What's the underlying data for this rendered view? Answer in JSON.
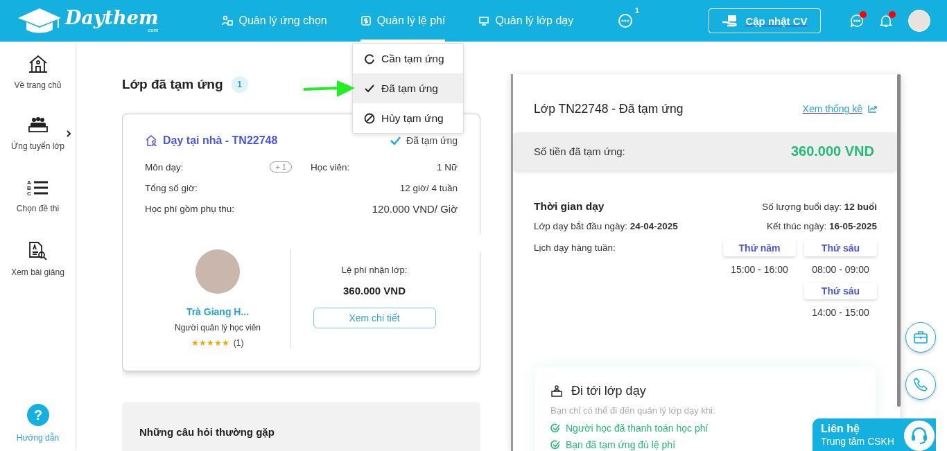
{
  "header": {
    "logo": {
      "name": "Daythem",
      "suffix": "com"
    },
    "nav": [
      {
        "label": "Quản lý ứng chọn",
        "selected": false
      },
      {
        "label": "Quản lý lệ phí",
        "selected": true
      },
      {
        "label": "Quản lý lớp dạy",
        "selected": false
      }
    ],
    "more_badge": "1",
    "cv_button": "Cập nhật CV",
    "chat_unread": true,
    "bell_unread": true
  },
  "fee_menu": {
    "items": [
      {
        "label": "Cần tạm ứng",
        "selected": false
      },
      {
        "label": "Đã tạm ứng",
        "selected": true
      },
      {
        "label": "Hủy tạm ứng",
        "selected": false
      }
    ]
  },
  "sidebar": {
    "items": [
      {
        "label": "Về trang chủ",
        "has_submenu": false
      },
      {
        "label": "Ứng tuyển lớp",
        "has_submenu": true
      },
      {
        "label": "Chọn đề thi",
        "has_submenu": false,
        "icon_letters": [
          "A",
          "B",
          "C"
        ]
      },
      {
        "label": "Xem bài giảng",
        "has_submenu": false
      }
    ],
    "help_icon": "?",
    "help": "Hướng dẫn"
  },
  "section": {
    "title": "Lớp đã tạm ứng",
    "count": "1"
  },
  "class_card": {
    "title": "Dạy tại nhà - TN22748",
    "status": "Đã tạm ứng",
    "subject": {
      "label": "Môn dạy:",
      "more": "+ 1"
    },
    "student": {
      "label": "Học viên:",
      "value": "1 Nữ"
    },
    "rows": [
      {
        "label": "Tổng số giờ:",
        "value": "12 giờ/ 4 tuần"
      },
      {
        "label": "Học phí gồm phụ thu:",
        "value": "120.000 VND/ Giờ"
      }
    ],
    "manager": {
      "name": "Trà Giang H...",
      "role": "Người quản lý học viên",
      "stars": 5,
      "reviews": "(1)"
    },
    "fee": {
      "label": "Lệ phí nhận lớp:",
      "amount": "360.000 VND"
    },
    "details_button": "Xem chi tiết"
  },
  "faq": {
    "title": "Những câu hỏi thường gặp"
  },
  "detail": {
    "title": "Lớp TN22748 - Đã tạm ứng",
    "stats_link": "Xem thống kê",
    "advance": {
      "label": "Số tiền đã tạm ứng:",
      "amount": "360.000 VND"
    },
    "schedule": {
      "title": "Thời gian dạy",
      "sessions": "Số lượng buổi dạy: **12 buổi**",
      "start": "Lớp dạy bắt đầu ngày: **24-04-2025**",
      "end": "Kết thúc ngày: **16-05-2025**",
      "weekly_label": "Lịch dạy hàng tuần:",
      "columns": [
        {
          "slots": [
            {
              "day": "Thứ năm",
              "time": "15:00 - 16:00"
            }
          ]
        },
        {
          "slots": [
            {
              "day": "Thứ sáu",
              "time": "08:00 - 09:00"
            },
            {
              "day": "Thứ sáu",
              "time": "14:00 - 15:00"
            }
          ]
        }
      ]
    },
    "go_to_class": {
      "title": "Đi tới lớp dạy",
      "hint": "Bạn chỉ có thể đi đến quản lý lớp dạy khi:",
      "conditions": [
        {
          "text": "Người học đã thanh toán học phí",
          "met": true
        },
        {
          "text": "Bạn đã tạm ứng đủ lệ phí",
          "met": true
        }
      ]
    }
  },
  "contact": {
    "title": "Liên hệ",
    "subtitle": "Trung tâm CSKH"
  }
}
